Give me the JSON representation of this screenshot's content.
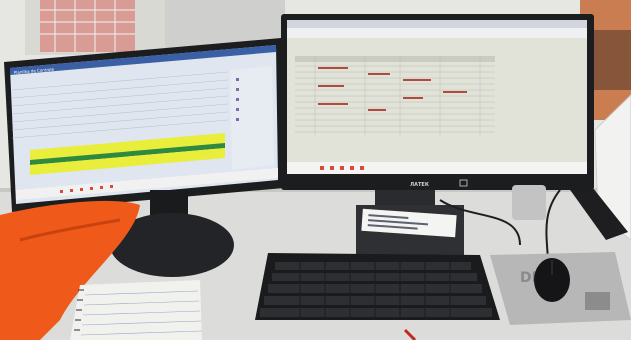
{
  "scene": {
    "description_visible_text": true
  },
  "left_monitor": {
    "window_title": "Planilha de Controle",
    "brand": ""
  },
  "right_monitor": {
    "brand": "ЛАТЕК",
    "window_title": ""
  },
  "mousepad": {
    "logo_text": "DE"
  },
  "colors": {
    "wall": "#e9e9e6",
    "desk": "#dcdcda",
    "monitor_bezel": "#1c1d1f",
    "screen_left": "#dfe6ef",
    "screen_right": "#d9dccf",
    "highlight_yellow": "#e8ee3a",
    "highlight_green": "#2f8a3b",
    "orange_cloth": "#ef5a1a",
    "keyboard": "#1a1b1d",
    "mousepad": "#b7b7b7"
  }
}
